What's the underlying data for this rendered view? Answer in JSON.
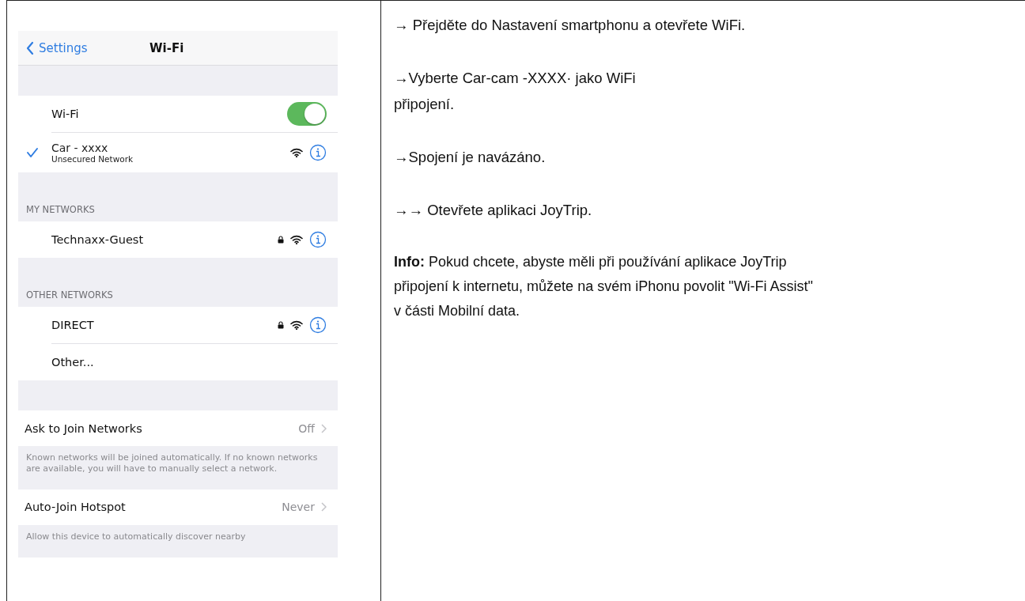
{
  "phone": {
    "nav": {
      "back": "Settings",
      "title": "Wi-Fi"
    },
    "wifi_toggle": {
      "label": "Wi-Fi",
      "on": true
    },
    "connected": {
      "name": "Car - xxxx",
      "status": "Unsecured Network",
      "selected": true
    },
    "sections": [
      {
        "header": "MY NETWORKS",
        "networks": [
          {
            "kind": "network",
            "name": "Technaxx-Guest",
            "locked": true
          }
        ]
      },
      {
        "header": "OTHER NETWORKS",
        "networks": [
          {
            "kind": "network",
            "name": "DIRECT",
            "locked": true
          },
          {
            "kind": "other",
            "name": "Other..."
          }
        ]
      }
    ],
    "settings": [
      {
        "label": "Ask to Join Networks",
        "value": "Off",
        "note": "Known networks will be joined automatically. If no known networks are available, you will have to manually select a network."
      },
      {
        "label": "Auto-Join Hotspot",
        "value": "Never",
        "note": "Allow this device to automatically discover nearby"
      }
    ]
  },
  "steps": [
    {
      "lines": [
        "→ Přejděte do Nastavení smartphonu a otevřete WiFi."
      ]
    },
    {
      "lines": [
        "→Vyberte Car-cam -XXXX· jako WiFi",
        "připojení."
      ]
    },
    {
      "lines": [
        "→Spojení je navázáno."
      ]
    },
    {
      "lines": [
        "→→ Otevřete aplikaci JoyTrip."
      ]
    }
  ],
  "info": "**Info:** Pokud chcete, abyste měli při používání aplikace JoyTrip připojení k internetu, můžete na svém iPhonu povolit \"Wi-Fi Assist\" v části Mobilní data."
}
